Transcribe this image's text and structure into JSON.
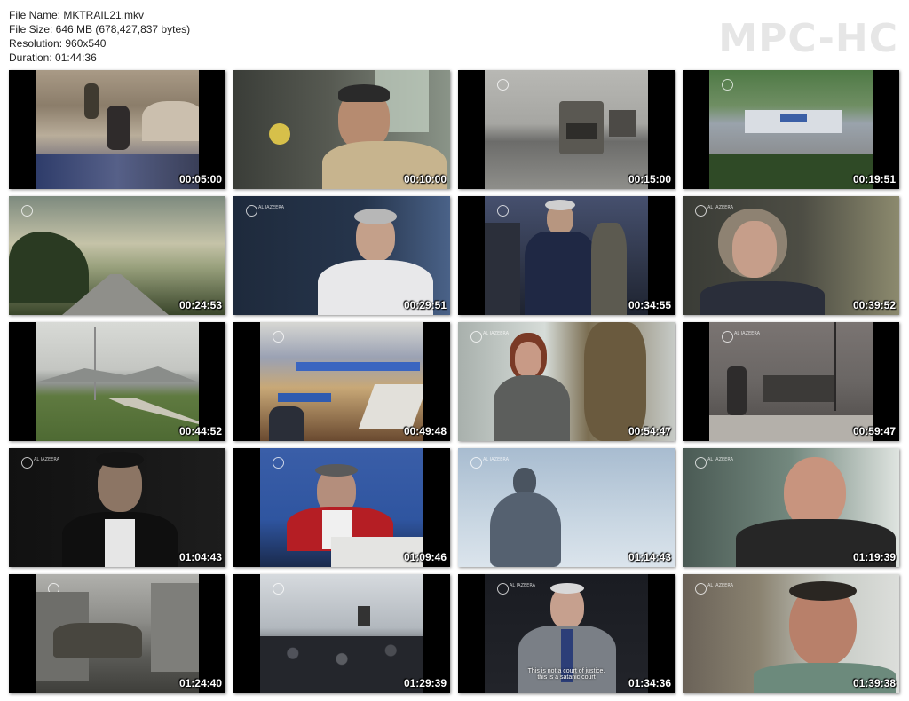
{
  "file_info": {
    "name": "File Name: MKTRAIL21.mkv",
    "size": "File Size: 646 MB (678,427,837 bytes)",
    "resolution": "Resolution: 960x540",
    "duration": "Duration: 01:44:36"
  },
  "brand": "MPC-HC",
  "channel_label": "AL JAZEERA",
  "thumbnails": [
    {
      "time": "00:05:00",
      "scene": "rubble-woman"
    },
    {
      "time": "00:10:00",
      "scene": "interview-man-glasses"
    },
    {
      "time": "00:15:00",
      "scene": "truck-convoy"
    },
    {
      "time": "00:19:51",
      "scene": "un-base-srebrenica"
    },
    {
      "time": "00:24:53",
      "scene": "country-road"
    },
    {
      "time": "00:29:51",
      "scene": "interview-grey-hair"
    },
    {
      "time": "00:34:55",
      "scene": "crowd-man-coat"
    },
    {
      "time": "00:39:52",
      "scene": "elderly-woman"
    },
    {
      "time": "00:44:52",
      "scene": "field-mountains"
    },
    {
      "time": "00:49:48",
      "scene": "courtroom-wide"
    },
    {
      "time": "00:54:47",
      "scene": "woman-scarf"
    },
    {
      "time": "00:59:47",
      "scene": "snowy-street"
    },
    {
      "time": "01:04:43",
      "scene": "lawyer-robe"
    },
    {
      "time": "01:09:46",
      "scene": "judge-red-robe"
    },
    {
      "time": "01:14:43",
      "scene": "statue-sky"
    },
    {
      "time": "01:19:39",
      "scene": "bald-man"
    },
    {
      "time": "01:24:40",
      "scene": "ruined-car"
    },
    {
      "time": "01:29:39",
      "scene": "audience-hall"
    },
    {
      "time": "01:34:36",
      "scene": "man-in-suit"
    },
    {
      "time": "01:39:38",
      "scene": "man-speaking"
    }
  ],
  "subtitles": {
    "line1": "This is not a court of justice,",
    "line2": "this is a satanic court"
  }
}
